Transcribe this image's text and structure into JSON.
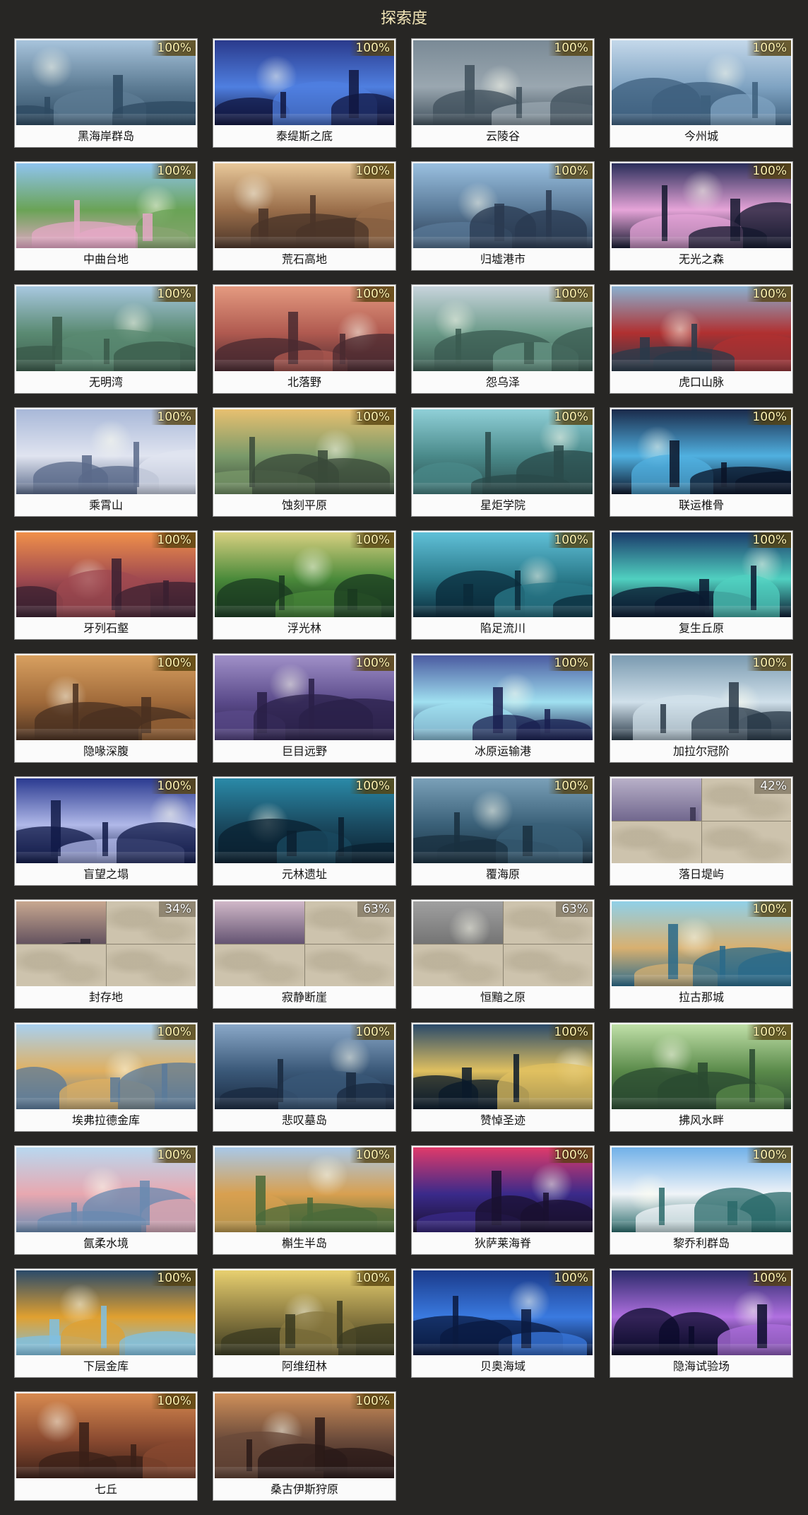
{
  "page": {
    "title": "探索度"
  },
  "colors": {
    "background": "#272624",
    "title": "#f3e6b8",
    "card": "#fbfbfb",
    "badge_text": "#fff3b0"
  },
  "regions": [
    {
      "name": "黑海岸群岛",
      "progress": "100%",
      "palette": [
        "#a8c4dc",
        "#5d7c94",
        "#2e4a62"
      ]
    },
    {
      "name": "泰缇斯之底",
      "progress": "100%",
      "palette": [
        "#2a3a8c",
        "#4f7fe0",
        "#101640"
      ]
    },
    {
      "name": "云陵谷",
      "progress": "100%",
      "palette": [
        "#7a8a96",
        "#9aa7b0",
        "#40505c"
      ]
    },
    {
      "name": "今州城",
      "progress": "100%",
      "palette": [
        "#c4d8ea",
        "#7fa3c2",
        "#3d5f7d"
      ]
    },
    {
      "name": "中曲台地",
      "progress": "100%",
      "palette": [
        "#8fc4ee",
        "#6aa356",
        "#e4a8c6"
      ]
    },
    {
      "name": "荒石高地",
      "progress": "100%",
      "palette": [
        "#e8c89a",
        "#9a6e4a",
        "#4a3428"
      ]
    },
    {
      "name": "归墟港市",
      "progress": "100%",
      "palette": [
        "#9ac0e0",
        "#5a7a98",
        "#2a3a50"
      ]
    },
    {
      "name": "无光之森",
      "progress": "100%",
      "palette": [
        "#2a2e5a",
        "#e6a4d8",
        "#14182e"
      ]
    },
    {
      "name": "无明湾",
      "progress": "100%",
      "palette": [
        "#a8c8e0",
        "#5a8a72",
        "#3a5a4a"
      ]
    },
    {
      "name": "北落野",
      "progress": "100%",
      "palette": [
        "#e49a80",
        "#b05a50",
        "#4a2a30"
      ]
    },
    {
      "name": "怨乌泽",
      "progress": "100%",
      "palette": [
        "#c8d4dc",
        "#6a9a88",
        "#3a5a50"
      ]
    },
    {
      "name": "虎口山脉",
      "progress": "100%",
      "palette": [
        "#8ab0d0",
        "#b03030",
        "#2a3a4a"
      ]
    },
    {
      "name": "乘霄山",
      "progress": "100%",
      "palette": [
        "#a8b8d8",
        "#e0e4f0",
        "#5a6a8a"
      ]
    },
    {
      "name": "蚀刻平原",
      "progress": "100%",
      "palette": [
        "#e8c070",
        "#7a9a6a",
        "#3a4a3a"
      ]
    },
    {
      "name": "星炬学院",
      "progress": "100%",
      "palette": [
        "#90d0d8",
        "#4a8a8a",
        "#2a4a4a"
      ]
    },
    {
      "name": "联运椎骨",
      "progress": "100%",
      "palette": [
        "#1a2a4a",
        "#50b0e0",
        "#0a1428"
      ]
    },
    {
      "name": "牙列石壑",
      "progress": "100%",
      "palette": [
        "#f0904a",
        "#a04a50",
        "#3a2030"
      ]
    },
    {
      "name": "浮光林",
      "progress": "100%",
      "palette": [
        "#d8d080",
        "#4a8a3a",
        "#1a3a20"
      ]
    },
    {
      "name": "陷足流川",
      "progress": "100%",
      "palette": [
        "#60c0d8",
        "#2a7a8a",
        "#0a2a3a"
      ]
    },
    {
      "name": "复生丘原",
      "progress": "100%",
      "palette": [
        "#1a3a6a",
        "#50d0c0",
        "#0a1a30"
      ]
    },
    {
      "name": "隐喙深腹",
      "progress": "100%",
      "palette": [
        "#d8a060",
        "#a06a3a",
        "#4a3020"
      ]
    },
    {
      "name": "巨目远野",
      "progress": "100%",
      "palette": [
        "#a090c8",
        "#5a4a8a",
        "#2a2048"
      ]
    },
    {
      "name": "冰原运输港",
      "progress": "100%",
      "palette": [
        "#4a5aa0",
        "#a0e0f0",
        "#1a2050"
      ]
    },
    {
      "name": "加拉尔冠阶",
      "progress": "100%",
      "palette": [
        "#7a9ab0",
        "#d0e0ea",
        "#2a3a48"
      ]
    },
    {
      "name": "盲望之塌",
      "progress": "100%",
      "palette": [
        "#2a3a90",
        "#b0b8e8",
        "#101a48"
      ]
    },
    {
      "name": "元林遗址",
      "progress": "100%",
      "palette": [
        "#2a8aa8",
        "#1a4a60",
        "#0a2030"
      ]
    },
    {
      "name": "覆海原",
      "progress": "100%",
      "palette": [
        "#7aa0b8",
        "#3a6078",
        "#1a3040"
      ]
    },
    {
      "name": "落日堤屿",
      "progress": "42%",
      "palette": [
        "#b8b0c8",
        "#6a6088",
        "#3a3450"
      ]
    },
    {
      "name": "封存地",
      "progress": "34%",
      "palette": [
        "#c8a890",
        "#5a4a5a",
        "#2a2430"
      ]
    },
    {
      "name": "寂静断崖",
      "progress": "63%",
      "palette": [
        "#d0b8c8",
        "#5a4a6a",
        "#2a2038"
      ]
    },
    {
      "name": "恒黯之原",
      "progress": "63%",
      "palette": [
        "#a0a0a0",
        "#707070",
        "#404040"
      ]
    },
    {
      "name": "拉古那城",
      "progress": "100%",
      "palette": [
        "#90d0e8",
        "#d8b070",
        "#2a6a8a"
      ]
    },
    {
      "name": "埃弗拉德金库",
      "progress": "100%",
      "palette": [
        "#a8d0f0",
        "#e0b060",
        "#5a7a9a"
      ]
    },
    {
      "name": "悲叹墓岛",
      "progress": "100%",
      "palette": [
        "#8aa8c8",
        "#3a5878",
        "#1a2a40"
      ]
    },
    {
      "name": "赞悼圣迹",
      "progress": "100%",
      "palette": [
        "#2a4a6a",
        "#e0c060",
        "#0a1a2a"
      ]
    },
    {
      "name": "拂风水畔",
      "progress": "100%",
      "palette": [
        "#c0e0a8",
        "#5a8a4a",
        "#2a4a30"
      ]
    },
    {
      "name": "氤柔水境",
      "progress": "100%",
      "palette": [
        "#b8d8f0",
        "#e8a8b0",
        "#6a8ab0"
      ]
    },
    {
      "name": "槲生半岛",
      "progress": "100%",
      "palette": [
        "#a8c8e8",
        "#d8a050",
        "#4a6a3a"
      ]
    },
    {
      "name": "狄萨莱海脊",
      "progress": "100%",
      "palette": [
        "#e03a6a",
        "#3a2a8a",
        "#1a1030"
      ]
    },
    {
      "name": "黎乔利群岛",
      "progress": "100%",
      "palette": [
        "#70b0e8",
        "#f0f4f8",
        "#2a6a6a"
      ]
    },
    {
      "name": "下层金库",
      "progress": "100%",
      "palette": [
        "#2a4a6a",
        "#e0a030",
        "#80c0e0"
      ]
    },
    {
      "name": "阿维纽林",
      "progress": "100%",
      "palette": [
        "#e8d070",
        "#8a7a40",
        "#3a3a20"
      ]
    },
    {
      "name": "贝奥海域",
      "progress": "100%",
      "palette": [
        "#1a3a8a",
        "#3a7ae0",
        "#0a1a40"
      ]
    },
    {
      "name": "隐海试验场",
      "progress": "100%",
      "palette": [
        "#2a2a6a",
        "#b070e0",
        "#0a0a2a"
      ]
    },
    {
      "name": "七丘",
      "progress": "100%",
      "palette": [
        "#d88a50",
        "#8a4a30",
        "#3a2018"
      ]
    },
    {
      "name": "桑古伊斯狩原",
      "progress": "100%",
      "palette": [
        "#d0905a",
        "#6a4a3a",
        "#2a1a18"
      ]
    }
  ]
}
